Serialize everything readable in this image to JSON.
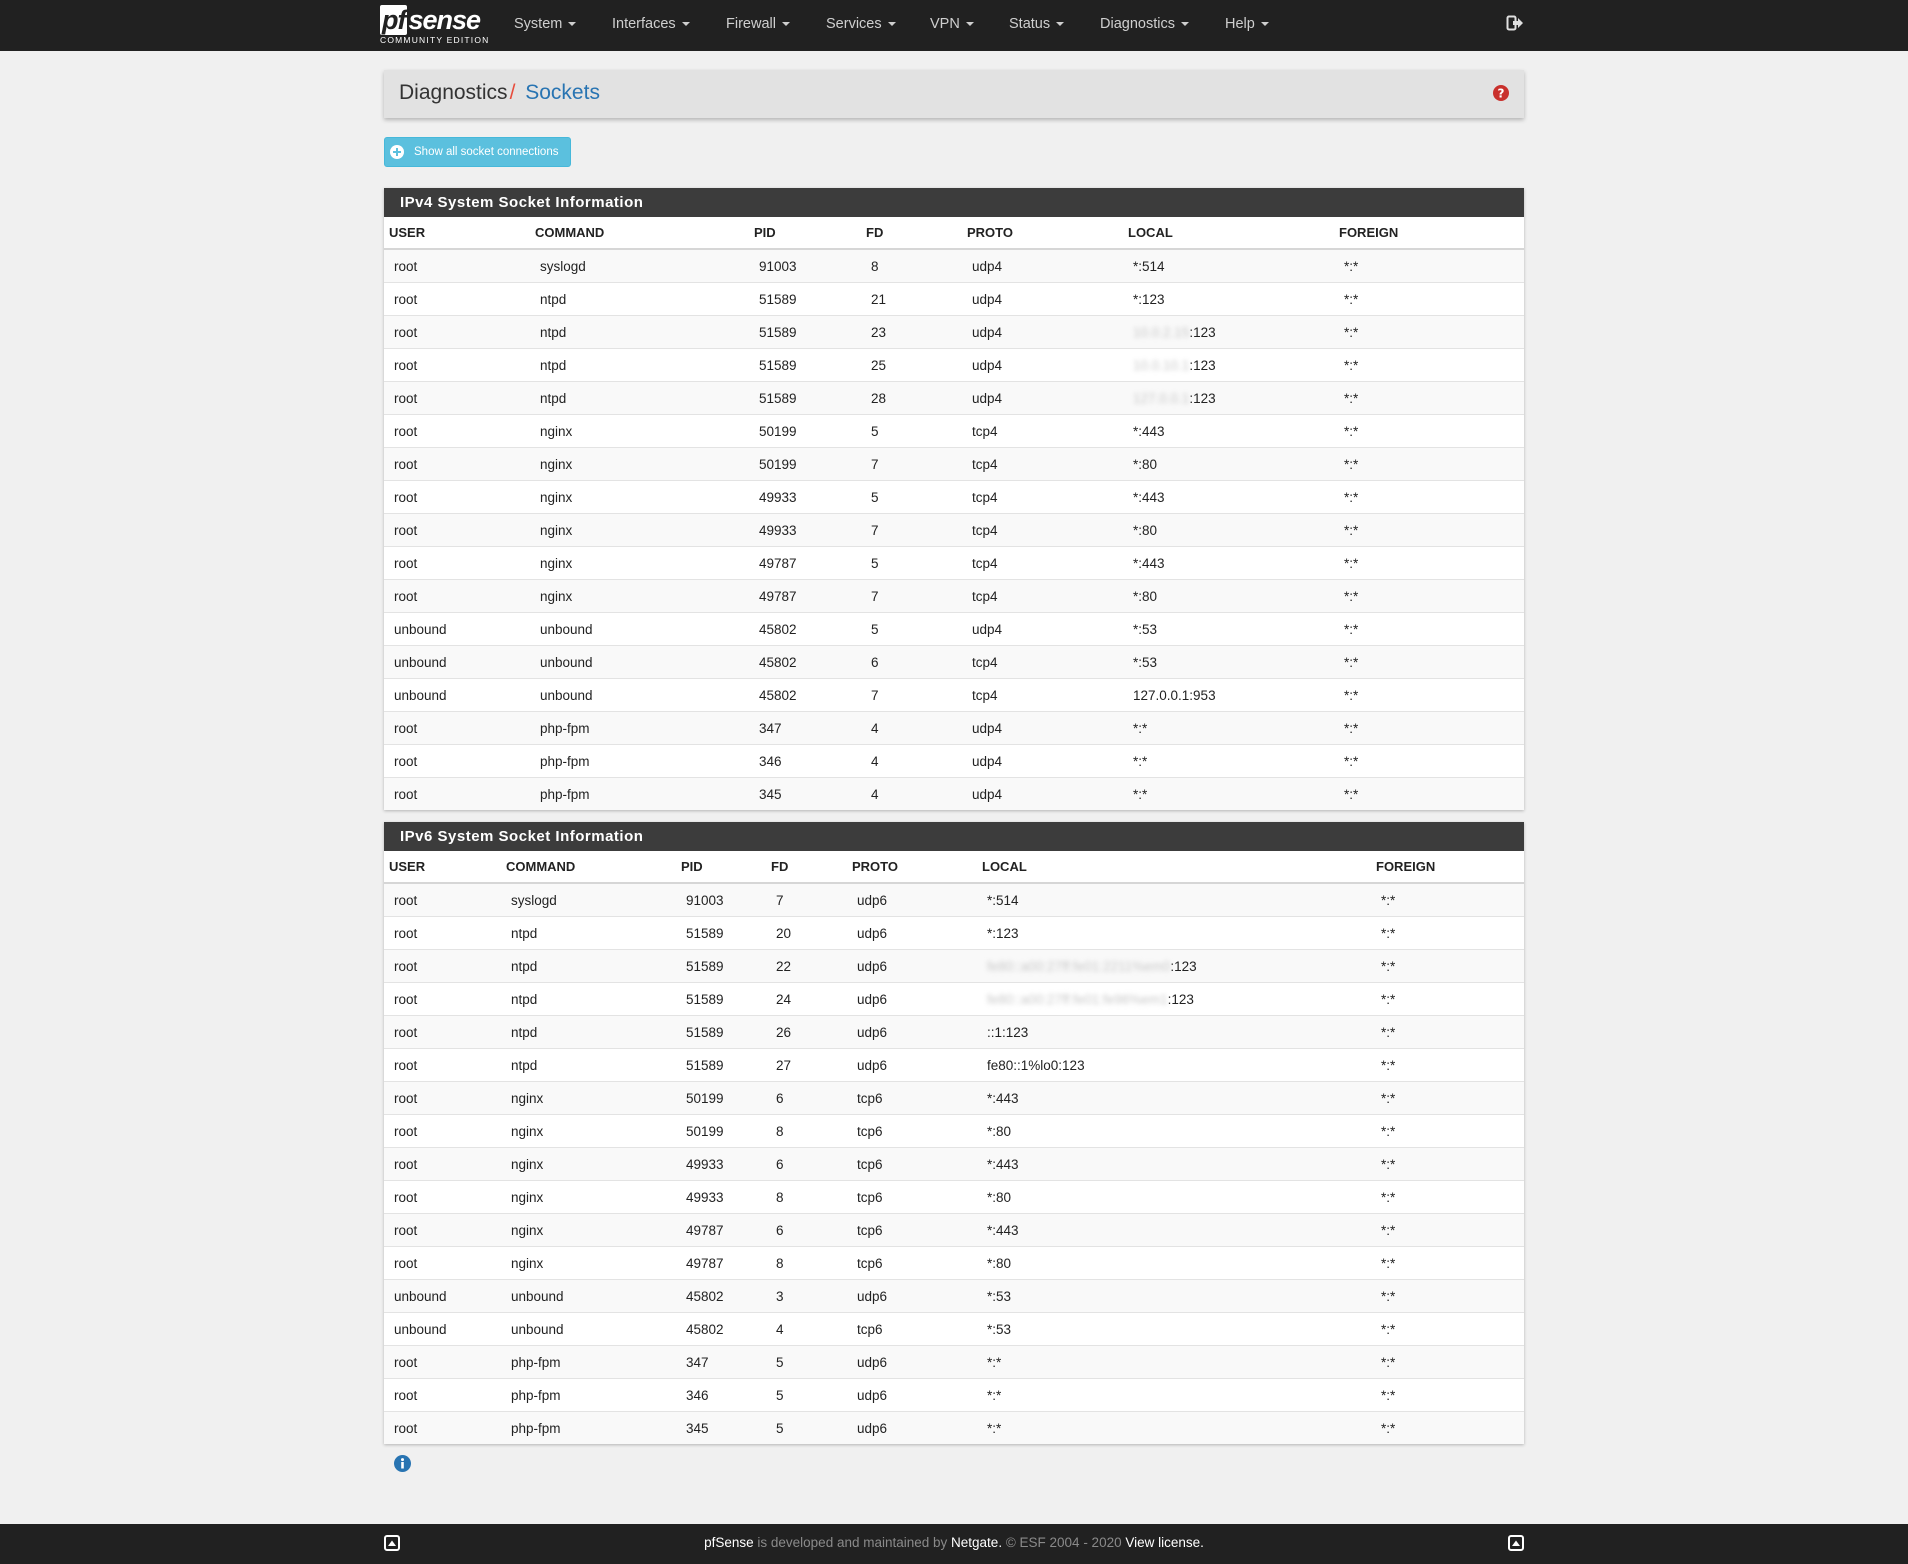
{
  "nav": {
    "brand": "sense",
    "brand_pf": "pf",
    "edition": "COMMUNITY EDITION",
    "menus": [
      "System",
      "Interfaces",
      "Firewall",
      "Services",
      "VPN",
      "Status",
      "Diagnostics",
      "Help"
    ]
  },
  "breadcrumb": {
    "root": "Diagnostics",
    "separator": "/",
    "page": "Sockets"
  },
  "show_all_button": "Show all socket connections",
  "columns": [
    "USER",
    "COMMAND",
    "PID",
    "FD",
    "PROTO",
    "LOCAL",
    "FOREIGN"
  ],
  "ipv4": {
    "title": "IPv4 System Socket Information",
    "rows": [
      [
        "root",
        "syslogd",
        "91003",
        "8",
        "udp4",
        "*:514",
        "*:*"
      ],
      [
        "root",
        "ntpd",
        "51589",
        "21",
        "udp4",
        "*:123",
        "*:*"
      ],
      [
        "root",
        "ntpd",
        "51589",
        "23",
        "udp4",
        "10.0.2.15:123",
        "*:*"
      ],
      [
        "root",
        "ntpd",
        "51589",
        "25",
        "udp4",
        "10.0.10.1:123",
        "*:*"
      ],
      [
        "root",
        "ntpd",
        "51589",
        "28",
        "udp4",
        "127.0.0.1:123",
        "*:*"
      ],
      [
        "root",
        "nginx",
        "50199",
        "5",
        "tcp4",
        "*:443",
        "*:*"
      ],
      [
        "root",
        "nginx",
        "50199",
        "7",
        "tcp4",
        "*:80",
        "*:*"
      ],
      [
        "root",
        "nginx",
        "49933",
        "5",
        "tcp4",
        "*:443",
        "*:*"
      ],
      [
        "root",
        "nginx",
        "49933",
        "7",
        "tcp4",
        "*:80",
        "*:*"
      ],
      [
        "root",
        "nginx",
        "49787",
        "5",
        "tcp4",
        "*:443",
        "*:*"
      ],
      [
        "root",
        "nginx",
        "49787",
        "7",
        "tcp4",
        "*:80",
        "*:*"
      ],
      [
        "unbound",
        "unbound",
        "45802",
        "5",
        "udp4",
        "*:53",
        "*:*"
      ],
      [
        "unbound",
        "unbound",
        "45802",
        "6",
        "tcp4",
        "*:53",
        "*:*"
      ],
      [
        "unbound",
        "unbound",
        "45802",
        "7",
        "tcp4",
        "127.0.0.1:953",
        "*:*"
      ],
      [
        "root",
        "php-fpm",
        "347",
        "4",
        "udp4",
        "*:*",
        "*:*"
      ],
      [
        "root",
        "php-fpm",
        "346",
        "4",
        "udp4",
        "*:*",
        "*:*"
      ],
      [
        "root",
        "php-fpm",
        "345",
        "4",
        "udp4",
        "*:*",
        "*:*"
      ]
    ]
  },
  "ipv6": {
    "title": "IPv6 System Socket Information",
    "rows": [
      [
        "root",
        "syslogd",
        "91003",
        "7",
        "udp6",
        "*:514",
        "*:*"
      ],
      [
        "root",
        "ntpd",
        "51589",
        "20",
        "udp6",
        "*:123",
        "*:*"
      ],
      [
        "root",
        "ntpd",
        "51589",
        "22",
        "udp6",
        "fe80::a00:27ff:fe01:2211%em0:123",
        "*:*"
      ],
      [
        "root",
        "ntpd",
        "51589",
        "24",
        "udp6",
        "fe80::a00:27ff:fe01:fe96%em1:123",
        "*:*"
      ],
      [
        "root",
        "ntpd",
        "51589",
        "26",
        "udp6",
        "::1:123",
        "*:*"
      ],
      [
        "root",
        "ntpd",
        "51589",
        "27",
        "udp6",
        "fe80::1%lo0:123",
        "*:*"
      ],
      [
        "root",
        "nginx",
        "50199",
        "6",
        "tcp6",
        "*:443",
        "*:*"
      ],
      [
        "root",
        "nginx",
        "50199",
        "8",
        "tcp6",
        "*:80",
        "*:*"
      ],
      [
        "root",
        "nginx",
        "49933",
        "6",
        "tcp6",
        "*:443",
        "*:*"
      ],
      [
        "root",
        "nginx",
        "49933",
        "8",
        "tcp6",
        "*:80",
        "*:*"
      ],
      [
        "root",
        "nginx",
        "49787",
        "6",
        "tcp6",
        "*:443",
        "*:*"
      ],
      [
        "root",
        "nginx",
        "49787",
        "8",
        "tcp6",
        "*:80",
        "*:*"
      ],
      [
        "unbound",
        "unbound",
        "45802",
        "3",
        "udp6",
        "*:53",
        "*:*"
      ],
      [
        "unbound",
        "unbound",
        "45802",
        "4",
        "tcp6",
        "*:53",
        "*:*"
      ],
      [
        "root",
        "php-fpm",
        "347",
        "5",
        "udp6",
        "*:*",
        "*:*"
      ],
      [
        "root",
        "php-fpm",
        "346",
        "5",
        "udp6",
        "*:*",
        "*:*"
      ],
      [
        "root",
        "php-fpm",
        "345",
        "5",
        "udp6",
        "*:*",
        "*:*"
      ]
    ]
  },
  "footer": {
    "brand": "pfSense",
    "text1": " is developed and maintained by ",
    "company": "Netgate.",
    "text2": " © ESF 2004 - 2020 ",
    "license": "View license."
  },
  "colors": {
    "nav_bg": "#212121",
    "accent": "#2874b2",
    "separator": "#e74c3c",
    "info_button": "#5bc0de",
    "help_icon": "#c9302c"
  }
}
